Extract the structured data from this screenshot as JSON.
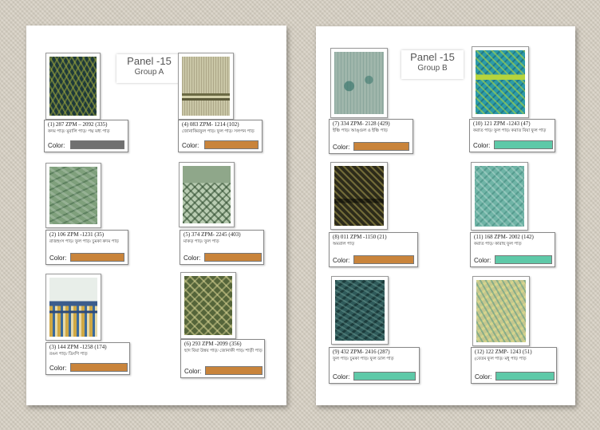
{
  "sheets": [
    {
      "panel_title": "Panel -15",
      "group": "Group A",
      "items": [
        {
          "code": "(1) 287 ZPM – 2092 (335)",
          "desc": "কদম পাড়/ মুরালি পাড়/ পদ্ম মধ্য পাড়",
          "color_label": "Color:",
          "color": "#707070",
          "fabric": "dark-olive"
        },
        {
          "code": "(4) 083 ZPM- 1214 (102)",
          "desc": "জোনাকিরফুল পাড়/ ফুল পাড়/ সলপন পাড়",
          "color_label": "Color:",
          "color": "#c9843b",
          "fabric": "beige-border"
        },
        {
          "code": "(2) 106 ZPM -1231 (35)",
          "desc": "রাজহংস পাড়/ ফুল পাড়/ চুমকা কদম পাড়",
          "color_label": "Color:",
          "color": "#c9843b",
          "fabric": "green-mottled"
        },
        {
          "code": "(5) 374 ZPM- 2245 (403)",
          "desc": "মাকড় পাড়/ ফুল পাড়",
          "color_label": "Color:",
          "color": "#c9843b",
          "fabric": "green-diamond"
        },
        {
          "code": "(3) 144 ZPM -1258 (174)",
          "desc": "রঙন পাড়/ ডিংগি পাড়",
          "color_label": "Color:",
          "color": "#c9843b",
          "fabric": "light-multicolor"
        },
        {
          "code": "(6) 293 ZPM -2099 (356)",
          "desc": "ছাদ বিয়া উন্নয় পাড়/ জোনাকী পাড়/ শাড়ী পাড়",
          "color_label": "Color:",
          "color": "#c9843b",
          "fabric": "olive-geometric"
        }
      ]
    },
    {
      "panel_title": "Panel -15",
      "group": "Group B",
      "items": [
        {
          "code": "(7) 334 ZPM- 2128 (429)",
          "desc": "ইঞ্চি পাড়/ আঙ্গুল ও ইঞ্চি পাড়",
          "color_label": "Color:",
          "color": "#c9843b",
          "fabric": "grey-teal"
        },
        {
          "code": "(10) 121 ZPM -1243 (47)",
          "desc": "করাত পাড়/ ফুল পাড়/ করাত বিয়া ফুল পাড়",
          "color_label": "Color:",
          "color": "#5ec9a8",
          "fabric": "bright-teal"
        },
        {
          "code": "(8) 011 ZPM -1150 (21)",
          "desc": "অমরাল পাড়",
          "color_label": "Color:",
          "color": "#c9843b",
          "fabric": "black-olive"
        },
        {
          "code": "(11) 168 ZPM- 2002 (142)",
          "desc": "করাত পাড়/ কারাছ ফুল পাড়",
          "color_label": "Color:",
          "color": "#5ec9a8",
          "fabric": "aqua"
        },
        {
          "code": "(9) 432 ZPM- 2416 (287)",
          "desc": "ফুল পাড়/ চুমকা পাড়/ ফুল ডাল পাড়",
          "color_label": "Color:",
          "color": "#5ec9a8",
          "fabric": "dark-teal"
        },
        {
          "code": "(12) 122 ZMP- 1243 (51)",
          "desc": "(বেতম ফুল পাড়/ মধু পাড় পাড়",
          "color_label": "Color:",
          "color": "#5ec9a8",
          "fabric": "yellow-teal"
        }
      ]
    }
  ]
}
